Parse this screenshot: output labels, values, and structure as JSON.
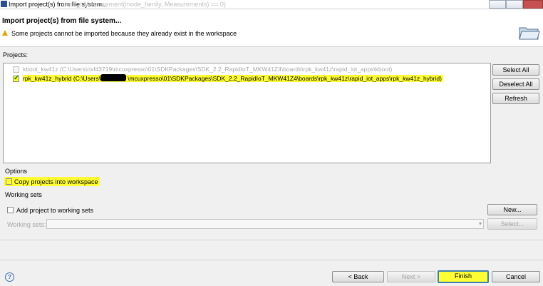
{
  "window": {
    "title": "Import project(s) from file system...",
    "ghost_text": "uint8_t Measurement(mode_family, Measurements) == 0)"
  },
  "header": {
    "title": "Import project(s) from file system...",
    "message": "Some projects cannot be imported because they already exist in the workspace"
  },
  "projects": {
    "label": "Projects:",
    "items": [
      {
        "label": "kboot_kw41z (C:\\Users\\nxf43719\\mcuxpresso\\01\\SDKPackages\\SDK_2.2_RapidIoT_MKW41Z4\\boards\\rpk_kw41z\\rapid_iot_apps\\kboot)",
        "checked": false,
        "enabled": false
      },
      {
        "label": "rpk_kw41z_hybrid (C:\\Users\\",
        "label_tail": "\\mcuxpresso\\01\\SDKPackages\\SDK_2.2_RapidIoT_MKW41Z4\\boards\\rpk_kw41z\\rapid_iot_apps\\rpk_kw41z_hybrid)",
        "checked": true,
        "enabled": true
      }
    ],
    "buttons": {
      "select_all": "Select All",
      "deselect_all": "Deselect All",
      "refresh": "Refresh"
    }
  },
  "options": {
    "label": "Options",
    "copy_checkbox": "Copy projects into workspace"
  },
  "working_sets": {
    "label": "Working sets",
    "add_checkbox": "Add project to working sets",
    "field_label": "Working sets:",
    "new_button": "New...",
    "select_button": "Select..."
  },
  "footer": {
    "back": "< Back",
    "next": "Next >",
    "finish": "Finish",
    "cancel": "Cancel"
  },
  "colors": {
    "highlight": "#ffff33"
  }
}
